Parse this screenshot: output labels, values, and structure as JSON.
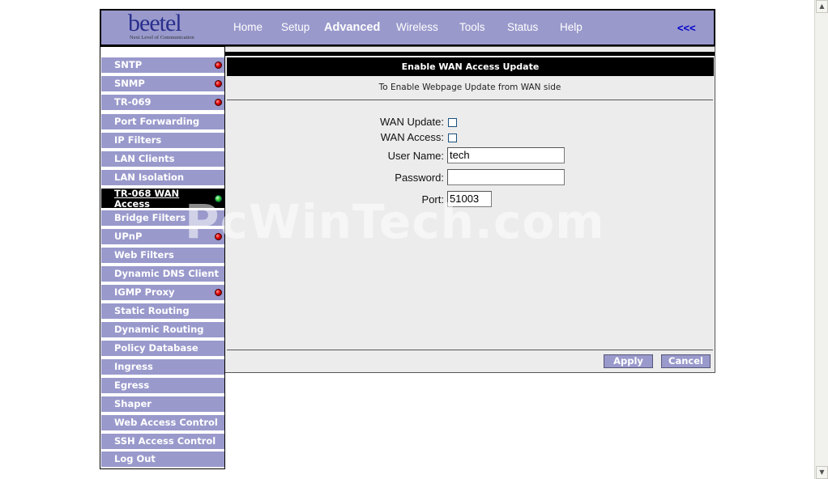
{
  "header": {
    "logo_text": "beetel",
    "logo_tagline": "Next Level of Communication",
    "nav": [
      "Home",
      "Setup",
      "Advanced",
      "Wireless",
      "Tools",
      "Status",
      "Help"
    ],
    "active_nav": "Advanced",
    "back_label": "<<<"
  },
  "sidebar": {
    "items": [
      {
        "label": "SNTP",
        "status": "red"
      },
      {
        "label": "SNMP",
        "status": "red"
      },
      {
        "label": "TR-069",
        "status": "red"
      },
      {
        "label": "Port Forwarding"
      },
      {
        "label": "IP Filters"
      },
      {
        "label": "LAN Clients"
      },
      {
        "label": "LAN Isolation"
      },
      {
        "label": "TR-068 WAN Access",
        "status": "green",
        "active": true
      },
      {
        "label": "Bridge Filters"
      },
      {
        "label": "UPnP",
        "status": "red"
      },
      {
        "label": "Web Filters"
      },
      {
        "label": "Dynamic DNS Client"
      },
      {
        "label": "IGMP Proxy",
        "status": "red"
      },
      {
        "label": "Static Routing"
      },
      {
        "label": "Dynamic Routing"
      },
      {
        "label": "Policy Database"
      },
      {
        "label": "Ingress"
      },
      {
        "label": "Egress"
      },
      {
        "label": "Shaper"
      },
      {
        "label": "Web Access Control"
      },
      {
        "label": "SSH Access Control"
      },
      {
        "label": "Log Out"
      }
    ]
  },
  "main": {
    "title": "Enable WAN Access Update",
    "subtitle": "To Enable Webpage Update from WAN side",
    "form": {
      "wan_update_label": "WAN Update:",
      "wan_update_checked": false,
      "wan_access_label": "WAN Access:",
      "wan_access_checked": false,
      "username_label": "User Name:",
      "username_value": "tech",
      "password_label": "Password:",
      "password_value": "",
      "port_label": "Port:",
      "port_value": "51003"
    },
    "apply_label": "Apply",
    "cancel_label": "Cancel"
  },
  "watermark": "PcWinTech.com",
  "colors": {
    "accent": "#9999cc",
    "header_bg": "#9999cc",
    "active_bg": "#000000",
    "panel_bg": "#ececec",
    "status_red": "#e00000",
    "status_green": "#33cc33",
    "back_link": "#0000cc"
  }
}
